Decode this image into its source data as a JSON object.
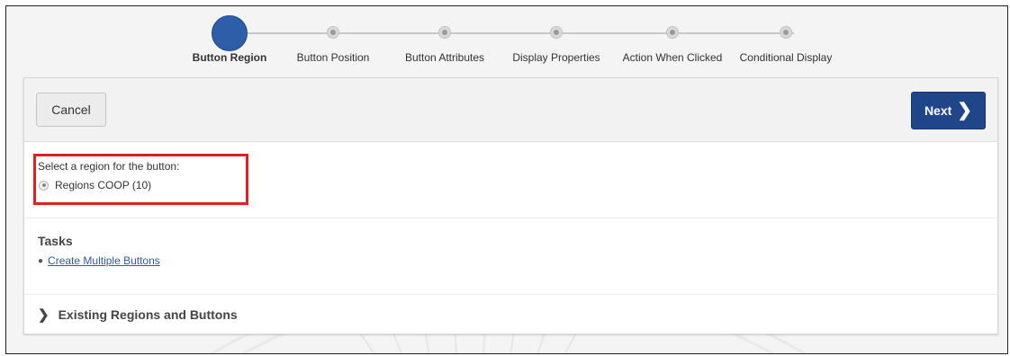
{
  "wizard": {
    "steps": [
      {
        "label": "Button Region",
        "active": true
      },
      {
        "label": "Button Position",
        "active": false
      },
      {
        "label": "Button Attributes",
        "active": false
      },
      {
        "label": "Display Properties",
        "active": false
      },
      {
        "label": "Action When Clicked",
        "active": false
      },
      {
        "label": "Conditional Display",
        "active": false
      }
    ]
  },
  "toolbar": {
    "cancel_label": "Cancel",
    "next_label": "Next",
    "next_icon": "chevron-right-icon",
    "accent_color": "#20468a"
  },
  "region_select": {
    "prompt": "Select a region for the button:",
    "options": [
      {
        "label": "Regions COOP (10)",
        "selected": true
      }
    ],
    "highlight_color": "#e41e25"
  },
  "tasks": {
    "title": "Tasks",
    "links": [
      "Create Multiple Buttons"
    ]
  },
  "existing": {
    "title": "Existing Regions and Buttons",
    "icon": "chevron-right-icon"
  }
}
